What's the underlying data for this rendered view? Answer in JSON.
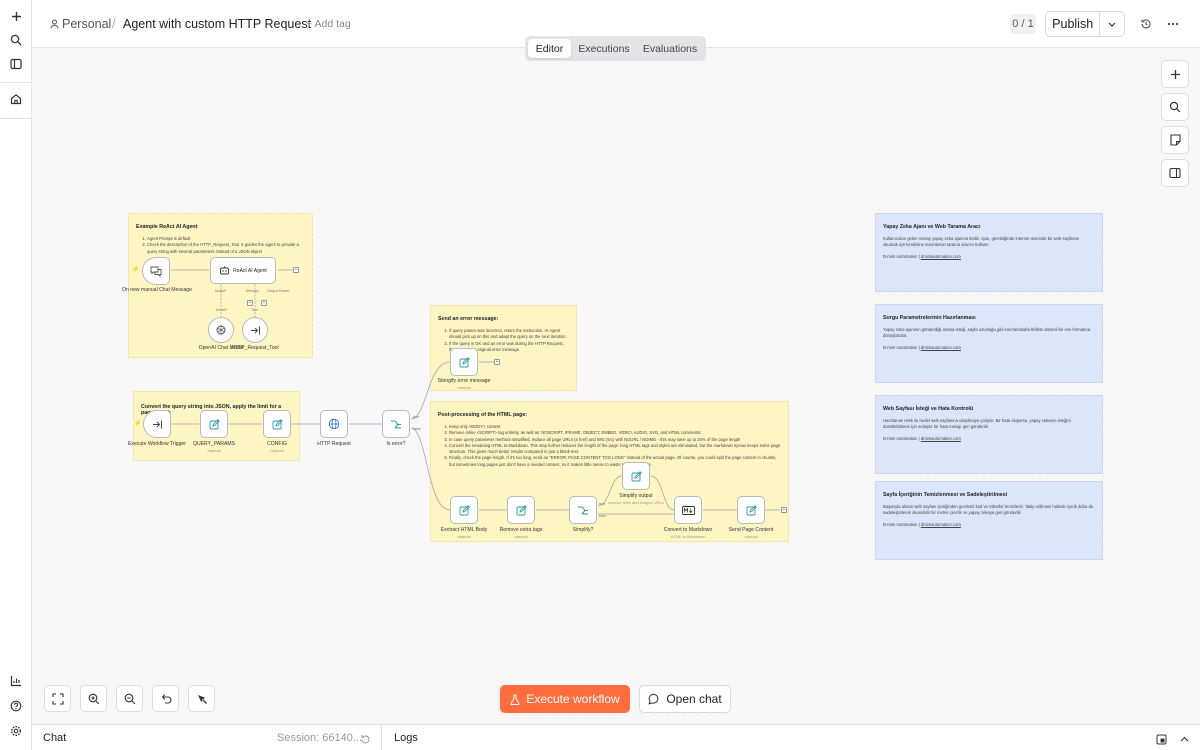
{
  "breadcrumb": {
    "project": "Personal",
    "separator": "/",
    "workflow_name": "Agent with custom HTTP Request",
    "add_tag": "+ Add tag"
  },
  "header": {
    "version_counter": "0 / 1",
    "publish_label": "Publish"
  },
  "tabs": [
    "Editor",
    "Executions",
    "Evaluations"
  ],
  "active_tab": "Editor",
  "left_rail": {
    "icons": [
      "plus-icon",
      "search-icon",
      "panel-icon",
      "home-icon",
      "insights-icon",
      "help-icon",
      "settings-icon"
    ]
  },
  "notes": {
    "react": {
      "title": "Example ReAct AI Agent",
      "items": [
        "Agent Prompt is default",
        "Check the description of the HTTP_Request_Tool. It guides the agent to provide a query string with several parameters instead of a JSON object"
      ]
    },
    "convert": {
      "title": "Convert the query string into JSON, apply the limit for a page length"
    },
    "error": {
      "title": "Send an error message:",
      "items": [
        "If query param was incorrect, return the instruction. AI Agent should pick up on this and adapt the query on the next iteration.",
        "If the query is OK and an error was during the HTTP Request, then return the original error message."
      ]
    },
    "post": {
      "title": "Post-processing of the HTML page:",
      "items": [
        "Keep only <BODY> content",
        "Remove inline <SCRIPT> tag entirely, as well as: NOSCRIPT, IFRAME, OBJECT, EMBED, VIDEO, AUDIO, SVG, and HTML comments;",
        "In case query parameter method=simplified, replace all page URLs (a href) and IMG (src) with NOURL / NOIMG - this may save up to 20% of the page length",
        "Convert the remaining HTML to Markdown. This step further reduces the length of the page: long HTML tags and styles are eliminated, but the markdown syntax keeps some page structure. This gives much better results compared to just a blank text.",
        "Finally, check the page length. If it's too long, send an \"ERROR: PAGE CONTENT TOO LONG\" instead of the actual page. Of course, you could split the page content in chunks, but sometimes long pages just don't have a needed content, so it makes little sense to waste tokens on them."
      ]
    },
    "blue1": {
      "title": "Yapay Zeka Ajanı ve Web Tarama Aracı",
      "body": "Kullanıcıdan gelen mesajı yapay zeka ajanına iletilir. Ajan, gerektiğinde internet üzerinde bir web sayfasını okumak için kendisine tanımlanan tarama aracını kullanır.",
      "footer_prefix": "D-mim Automation | ",
      "link": "dmimautomation.com"
    },
    "blue2": {
      "title": "Sorgu Parametrelerinin Hazırlanması",
      "body": "Yapay zeka ajanının gönderdiği arama isteği, sayfa uzunluğu gibi sınırlamalarla birlikte düzenli bir veri formatına dönüştürülür.",
      "footer_prefix": "D-mim Automation | ",
      "link": "dmimautomation.com"
    },
    "blue3": {
      "title": "Web Sayfası İsteği ve Hata Kontrolü",
      "body": "Hazırlanan istek ile hedef web sayfasına ulaşılmaya çalışılır. Bir hata oluşursa, yapay zekanın isteğini düzeltebilmesi için anlaşılır bir hata mesajı geri gönderilir.",
      "footer_prefix": "D-mim Automation | ",
      "link": "dmimautomation.com"
    },
    "blue4": {
      "title": "Sayfa İçeriğinin Temizlenmesi ve Sadeleştirilmesi",
      "body": "Başarıyla alınan web sayfası içeriğinden gereksiz kod ve etiketler temizlenir. Takip edilmesi halinde içerik daha da sadeleştirilerek okunabilir bir metne çevrilir ve yapay zekaya geri gönderilir.",
      "footer_prefix": "D-mim Automation | ",
      "link": "dmimautomation.com"
    }
  },
  "nodes": {
    "chat_trigger": {
      "label": "On new manual Chat Message"
    },
    "agent": {
      "label": "ReAct AI Agent",
      "port_model": "Model*",
      "port_tool": "Tool",
      "port_memory": "Memory",
      "port_output": "Output Parser"
    },
    "openai": {
      "label": "OpenAI Chat Model"
    },
    "http_tool": {
      "label": "HTTP_Request_Tool"
    },
    "exec_trigger": {
      "label": "Execute Workflow Trigger"
    },
    "query_params": {
      "label": "QUERY_PARAMS",
      "sub": "manual"
    },
    "config": {
      "label": "CONFIG",
      "sub": "manual"
    },
    "http_request": {
      "label": "HTTP Request"
    },
    "is_error": {
      "label": "Is error?",
      "true_label": "true",
      "false_label": "false"
    },
    "stringify": {
      "label": "Stringify error message",
      "sub": "manual"
    },
    "extract": {
      "label": "Exctract HTML Body",
      "sub": "manual"
    },
    "remove": {
      "label": "Remove extra tags",
      "sub": "manual"
    },
    "simplify": {
      "label": "Simplify?",
      "true_label": "true",
      "false_label": "false"
    },
    "simplify_out": {
      "label": "Simplify output",
      "sub": "remove links and images URLs"
    },
    "convert_md": {
      "label": "Convert to Markdown",
      "sub": "HTML to Markdown"
    },
    "send_page": {
      "label": "Send Page Content",
      "sub": "manual"
    }
  },
  "canvas_buttons": [
    "fit-view-button",
    "zoom-in-button",
    "zoom-out-button",
    "undo-button",
    "tidy-up-button"
  ],
  "actions": {
    "execute": "Execute workflow",
    "open_chat": "Open chat"
  },
  "footer": {
    "chat": "Chat",
    "session": "Session: 66140...",
    "logs": "Logs"
  },
  "colors": {
    "accent": "#ff6d3f",
    "sticky_yellow": "#fdf6c2",
    "sticky_blue": "#dbe6fb",
    "node_icon": "#2e9aa1",
    "chat_icon": "#555555"
  }
}
